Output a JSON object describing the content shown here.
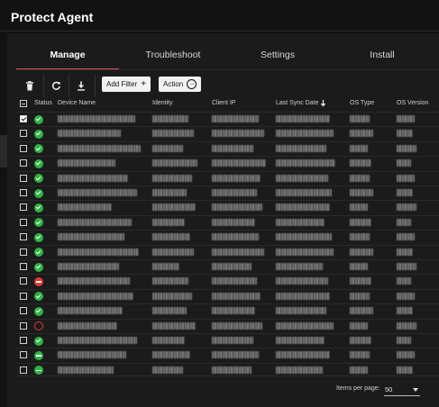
{
  "app": {
    "title": "Protect Agent"
  },
  "tabs": [
    {
      "label": "Manage",
      "active": true
    },
    {
      "label": "Troubleshoot",
      "active": false
    },
    {
      "label": "Settings",
      "active": false
    },
    {
      "label": "Install",
      "active": false
    }
  ],
  "toolbar": {
    "delete_icon": "trash-icon",
    "refresh_icon": "refresh-icon",
    "download_icon": "download-icon",
    "add_filter_label": "Add Filter",
    "action_label": "Action"
  },
  "table": {
    "columns": [
      "Status",
      "Device Name",
      "Identity",
      "Client IP",
      "Last Sync Date",
      "OS Type",
      "OS Version"
    ],
    "sort": {
      "column": "Last Sync Date",
      "direction": "descending"
    },
    "rows": [
      {
        "checked": true,
        "status": "online"
      },
      {
        "checked": false,
        "status": "online"
      },
      {
        "checked": false,
        "status": "online"
      },
      {
        "checked": false,
        "status": "online"
      },
      {
        "checked": false,
        "status": "online"
      },
      {
        "checked": false,
        "status": "online"
      },
      {
        "checked": false,
        "status": "online"
      },
      {
        "checked": false,
        "status": "online"
      },
      {
        "checked": false,
        "status": "online"
      },
      {
        "checked": false,
        "status": "online"
      },
      {
        "checked": false,
        "status": "online"
      },
      {
        "checked": false,
        "status": "blocked"
      },
      {
        "checked": false,
        "status": "online"
      },
      {
        "checked": false,
        "status": "online"
      },
      {
        "checked": false,
        "status": "offline"
      },
      {
        "checked": false,
        "status": "online"
      },
      {
        "checked": false,
        "status": "idle"
      },
      {
        "checked": false,
        "status": "idle"
      }
    ]
  },
  "pagination": {
    "items_per_page_label": "Items per page:",
    "items_per_page": "50"
  },
  "colors": {
    "accent": "#d9534f",
    "ok": "#2fb344",
    "error": "#e53935",
    "background": "#121212"
  }
}
